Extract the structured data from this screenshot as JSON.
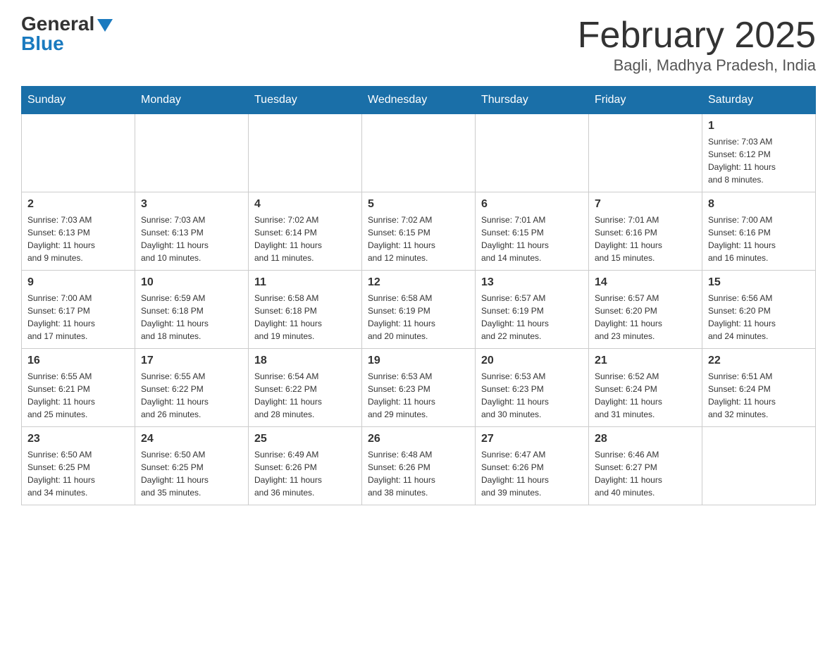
{
  "header": {
    "logo_general": "General",
    "logo_blue": "Blue",
    "month_title": "February 2025",
    "location": "Bagli, Madhya Pradesh, India"
  },
  "days_of_week": [
    "Sunday",
    "Monday",
    "Tuesday",
    "Wednesday",
    "Thursday",
    "Friday",
    "Saturday"
  ],
  "weeks": [
    [
      {
        "day": "",
        "info": ""
      },
      {
        "day": "",
        "info": ""
      },
      {
        "day": "",
        "info": ""
      },
      {
        "day": "",
        "info": ""
      },
      {
        "day": "",
        "info": ""
      },
      {
        "day": "",
        "info": ""
      },
      {
        "day": "1",
        "info": "Sunrise: 7:03 AM\nSunset: 6:12 PM\nDaylight: 11 hours\nand 8 minutes."
      }
    ],
    [
      {
        "day": "2",
        "info": "Sunrise: 7:03 AM\nSunset: 6:13 PM\nDaylight: 11 hours\nand 9 minutes."
      },
      {
        "day": "3",
        "info": "Sunrise: 7:03 AM\nSunset: 6:13 PM\nDaylight: 11 hours\nand 10 minutes."
      },
      {
        "day": "4",
        "info": "Sunrise: 7:02 AM\nSunset: 6:14 PM\nDaylight: 11 hours\nand 11 minutes."
      },
      {
        "day": "5",
        "info": "Sunrise: 7:02 AM\nSunset: 6:15 PM\nDaylight: 11 hours\nand 12 minutes."
      },
      {
        "day": "6",
        "info": "Sunrise: 7:01 AM\nSunset: 6:15 PM\nDaylight: 11 hours\nand 14 minutes."
      },
      {
        "day": "7",
        "info": "Sunrise: 7:01 AM\nSunset: 6:16 PM\nDaylight: 11 hours\nand 15 minutes."
      },
      {
        "day": "8",
        "info": "Sunrise: 7:00 AM\nSunset: 6:16 PM\nDaylight: 11 hours\nand 16 minutes."
      }
    ],
    [
      {
        "day": "9",
        "info": "Sunrise: 7:00 AM\nSunset: 6:17 PM\nDaylight: 11 hours\nand 17 minutes."
      },
      {
        "day": "10",
        "info": "Sunrise: 6:59 AM\nSunset: 6:18 PM\nDaylight: 11 hours\nand 18 minutes."
      },
      {
        "day": "11",
        "info": "Sunrise: 6:58 AM\nSunset: 6:18 PM\nDaylight: 11 hours\nand 19 minutes."
      },
      {
        "day": "12",
        "info": "Sunrise: 6:58 AM\nSunset: 6:19 PM\nDaylight: 11 hours\nand 20 minutes."
      },
      {
        "day": "13",
        "info": "Sunrise: 6:57 AM\nSunset: 6:19 PM\nDaylight: 11 hours\nand 22 minutes."
      },
      {
        "day": "14",
        "info": "Sunrise: 6:57 AM\nSunset: 6:20 PM\nDaylight: 11 hours\nand 23 minutes."
      },
      {
        "day": "15",
        "info": "Sunrise: 6:56 AM\nSunset: 6:20 PM\nDaylight: 11 hours\nand 24 minutes."
      }
    ],
    [
      {
        "day": "16",
        "info": "Sunrise: 6:55 AM\nSunset: 6:21 PM\nDaylight: 11 hours\nand 25 minutes."
      },
      {
        "day": "17",
        "info": "Sunrise: 6:55 AM\nSunset: 6:22 PM\nDaylight: 11 hours\nand 26 minutes."
      },
      {
        "day": "18",
        "info": "Sunrise: 6:54 AM\nSunset: 6:22 PM\nDaylight: 11 hours\nand 28 minutes."
      },
      {
        "day": "19",
        "info": "Sunrise: 6:53 AM\nSunset: 6:23 PM\nDaylight: 11 hours\nand 29 minutes."
      },
      {
        "day": "20",
        "info": "Sunrise: 6:53 AM\nSunset: 6:23 PM\nDaylight: 11 hours\nand 30 minutes."
      },
      {
        "day": "21",
        "info": "Sunrise: 6:52 AM\nSunset: 6:24 PM\nDaylight: 11 hours\nand 31 minutes."
      },
      {
        "day": "22",
        "info": "Sunrise: 6:51 AM\nSunset: 6:24 PM\nDaylight: 11 hours\nand 32 minutes."
      }
    ],
    [
      {
        "day": "23",
        "info": "Sunrise: 6:50 AM\nSunset: 6:25 PM\nDaylight: 11 hours\nand 34 minutes."
      },
      {
        "day": "24",
        "info": "Sunrise: 6:50 AM\nSunset: 6:25 PM\nDaylight: 11 hours\nand 35 minutes."
      },
      {
        "day": "25",
        "info": "Sunrise: 6:49 AM\nSunset: 6:26 PM\nDaylight: 11 hours\nand 36 minutes."
      },
      {
        "day": "26",
        "info": "Sunrise: 6:48 AM\nSunset: 6:26 PM\nDaylight: 11 hours\nand 38 minutes."
      },
      {
        "day": "27",
        "info": "Sunrise: 6:47 AM\nSunset: 6:26 PM\nDaylight: 11 hours\nand 39 minutes."
      },
      {
        "day": "28",
        "info": "Sunrise: 6:46 AM\nSunset: 6:27 PM\nDaylight: 11 hours\nand 40 minutes."
      },
      {
        "day": "",
        "info": ""
      }
    ]
  ]
}
